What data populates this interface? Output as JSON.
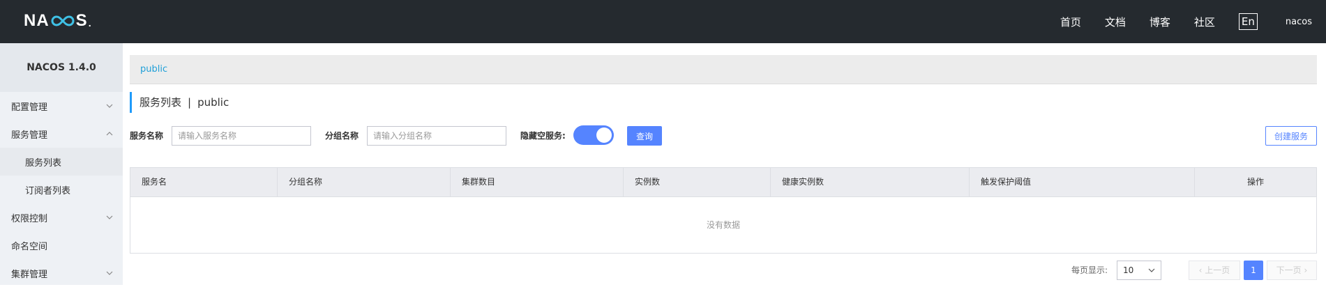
{
  "header": {
    "logo_text": "NACOS.",
    "nav": [
      "首页",
      "文档",
      "博客",
      "社区"
    ],
    "lang_label": "En",
    "user": "nacos"
  },
  "sidebar": {
    "version": "NACOS 1.4.0",
    "items": [
      {
        "label": "配置管理",
        "chevron": "down"
      },
      {
        "label": "服务管理",
        "chevron": "up"
      },
      {
        "label": "服务列表",
        "sub": true,
        "active": true
      },
      {
        "label": "订阅者列表",
        "sub": true
      },
      {
        "label": "权限控制",
        "chevron": "down"
      },
      {
        "label": "命名空间"
      },
      {
        "label": "集群管理",
        "chevron": "down"
      }
    ]
  },
  "main": {
    "breadcrumb": "public",
    "title": "服务列表",
    "title_separator": "|",
    "title_namespace": "public",
    "filters": {
      "service_name_label": "服务名称",
      "service_name_placeholder": "请输入服务名称",
      "group_name_label": "分组名称",
      "group_name_placeholder": "请输入分组名称",
      "hide_empty_label": "隐藏空服务:",
      "hide_empty_on": true,
      "query_label": "查询",
      "create_label": "创建服务"
    },
    "table": {
      "columns": [
        "服务名",
        "分组名称",
        "集群数目",
        "实例数",
        "健康实例数",
        "触发保护阈值",
        "操作"
      ],
      "rows": [],
      "empty_text": "没有数据"
    },
    "pagination": {
      "page_size_label": "每页显示:",
      "page_size": "10",
      "prev_label": "上一页",
      "next_label": "下一页",
      "current_page": "1"
    }
  },
  "colors": {
    "topbar_bg": "#252a2f",
    "primary": "#5584ff",
    "link": "#20a0d8"
  }
}
